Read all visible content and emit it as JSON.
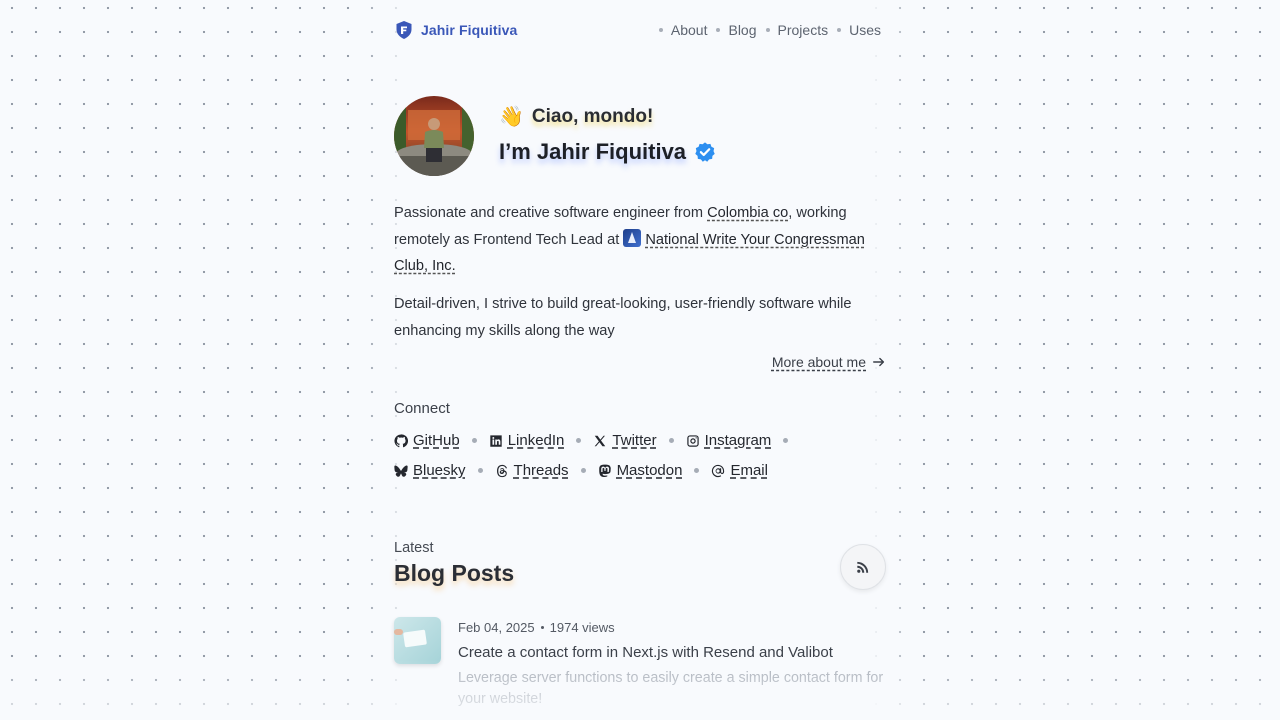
{
  "header": {
    "brand_name": "Jahir Fiquitiva",
    "brand_icon": "shield-logo-icon",
    "nav": [
      {
        "label": "About"
      },
      {
        "label": "Blog"
      },
      {
        "label": "Projects"
      },
      {
        "label": "Uses"
      }
    ]
  },
  "hero": {
    "greeting_emoji": "👋",
    "greeting": "Ciao, mondo!",
    "intro": "I’m Jahir Fiquitiva",
    "verified_icon": "verified-badge-icon",
    "para1_a": "Passionate and creative software engineer from ",
    "country_link": "Colombia co",
    "para1_b": ", working remotely as Frontend Tech Lead at ",
    "company_link": "National Write Your Congressman Club, Inc.",
    "para2": "Detail-driven, I strive to build great-looking, user-friendly software while enhancing my skills along the way",
    "more_link": "More about me"
  },
  "connect": {
    "title": "Connect",
    "links": [
      {
        "label": "GitHub",
        "icon": "github-icon"
      },
      {
        "label": "LinkedIn",
        "icon": "linkedin-icon"
      },
      {
        "label": "Twitter",
        "icon": "x-icon"
      },
      {
        "label": "Instagram",
        "icon": "instagram-icon"
      },
      {
        "label": "Bluesky",
        "icon": "bluesky-icon"
      },
      {
        "label": "Threads",
        "icon": "threads-icon"
      },
      {
        "label": "Mastodon",
        "icon": "mastodon-icon"
      },
      {
        "label": "Email",
        "icon": "at-icon"
      }
    ]
  },
  "blog": {
    "kicker": "Latest",
    "title": "Blog Posts",
    "rss_icon": "rss-icon",
    "posts": [
      {
        "date": "Feb 04, 2025",
        "views": "1974 views",
        "title": "Create a contact form in Next.js with Resend and Valibot",
        "description": "Leverage server functions to easily create a simple contact form for your website!"
      }
    ]
  },
  "colors": {
    "brand": "#3a57b8",
    "verified": "#2d8ff0",
    "background": "#f8fafd"
  }
}
